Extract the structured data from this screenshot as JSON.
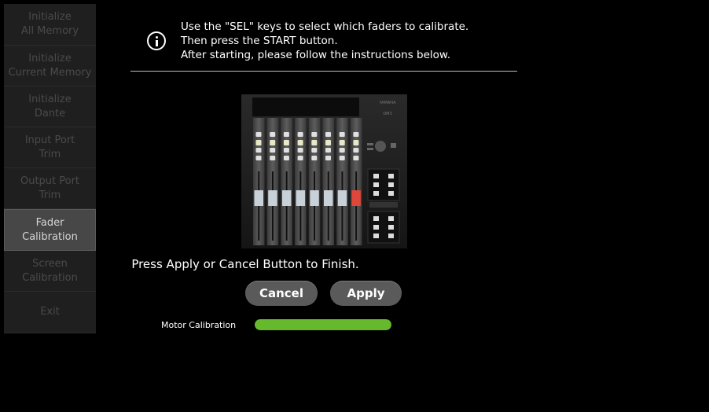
{
  "sidebar": {
    "items": [
      {
        "label": "Initialize\nAll Memory",
        "active": false
      },
      {
        "label": "Initialize\nCurrent Memory",
        "active": false
      },
      {
        "label": "Initialize\nDante",
        "active": false
      },
      {
        "label": "Input Port\nTrim",
        "active": false
      },
      {
        "label": "Output Port\nTrim",
        "active": false
      },
      {
        "label": "Fader\nCalibration",
        "active": true
      },
      {
        "label": "Screen\nCalibration",
        "active": false
      },
      {
        "label": "Exit",
        "active": false
      }
    ]
  },
  "instructions": {
    "icon": "info-icon",
    "line1": "Use the \"SEL\" keys to select which faders to calibrate.",
    "line2": "Then press the START button.",
    "line3": "After starting, please follow the instructions below."
  },
  "console_image": {
    "brand": "YAMAHA",
    "model": "DM3",
    "fader_count": 8,
    "selected_fader_index": 7
  },
  "finish_text": "Press Apply or Cancel Button to Finish.",
  "buttons": {
    "cancel": "Cancel",
    "apply": "Apply"
  },
  "progress": {
    "label": "Motor Calibration",
    "value": 1.0,
    "color": "#66b82d"
  }
}
